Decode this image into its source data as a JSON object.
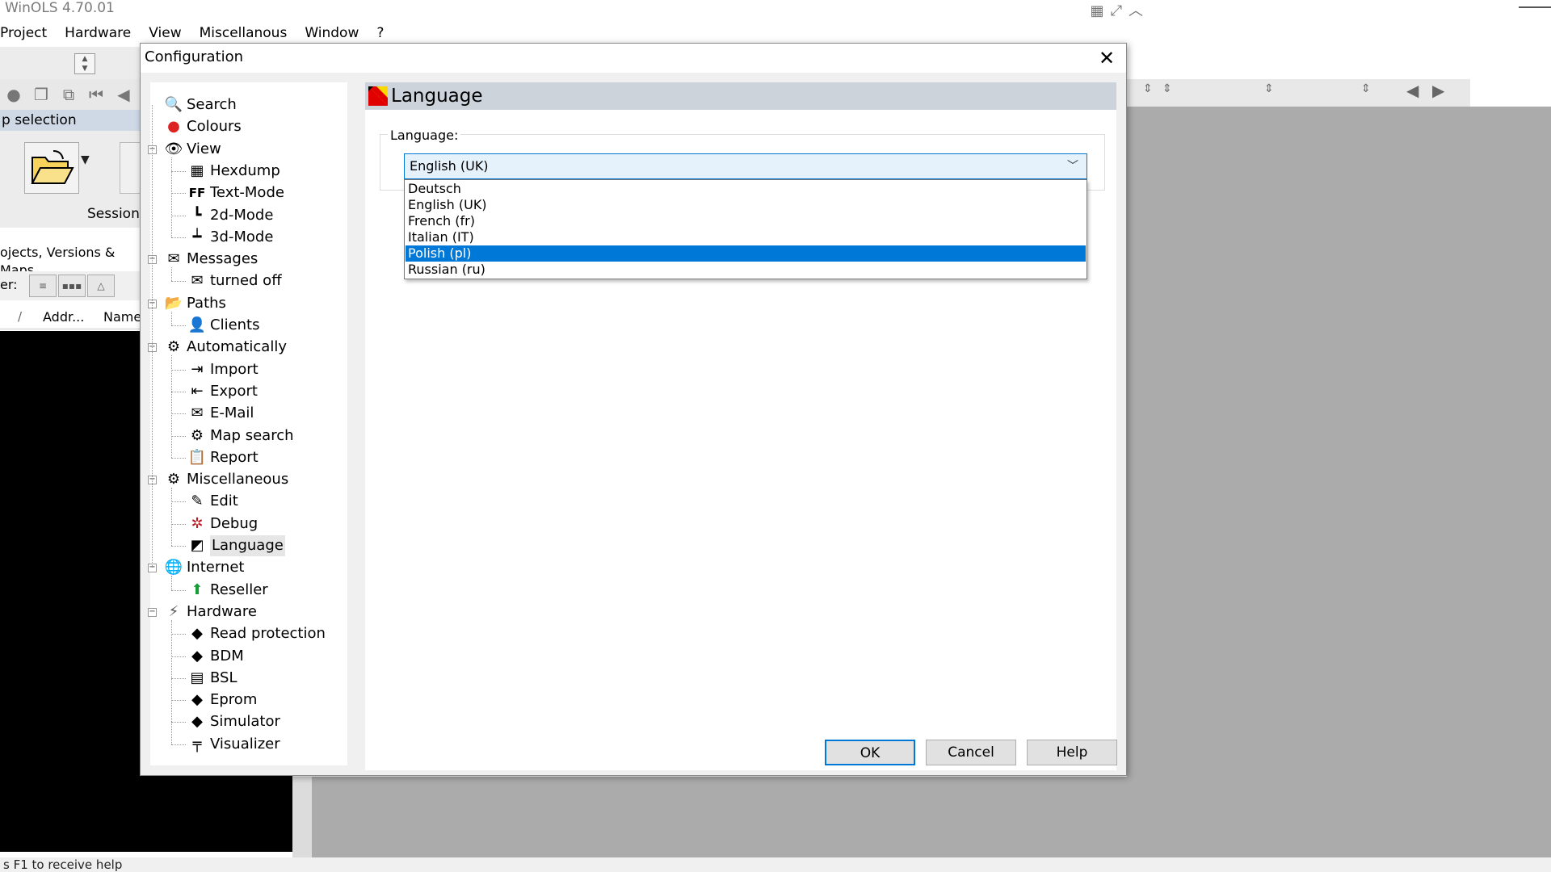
{
  "app": {
    "title": "WinOLS 4.70.01",
    "menu": [
      "Project",
      "Hardware",
      "View",
      "Miscellanous",
      "Window",
      "?"
    ]
  },
  "background": {
    "map_selection_title": "p selection",
    "session_label": "Session:",
    "projects_tab": "ojects, Versions & Maps",
    "filter_label": "er:",
    "col_slash": "/",
    "col_address": "Addr...",
    "col_name": "Name",
    "status_text": "s F1 to receive help"
  },
  "dialog": {
    "title": "Configuration",
    "close_glyph": "✕",
    "tree": [
      {
        "label": "Search",
        "icon": "search-icon",
        "glyph": "🔍"
      },
      {
        "label": "Colours",
        "icon": "colours-icon",
        "glyph": "●"
      },
      {
        "label": "View",
        "icon": "eye-icon",
        "glyph": "👁"
      },
      {
        "label": "Hexdump",
        "icon": "hexdump-icon",
        "glyph": "▦"
      },
      {
        "label": "Text-Mode",
        "icon": "text-mode-icon",
        "glyph": "FF"
      },
      {
        "label": "2d-Mode",
        "icon": "2d-mode-icon",
        "glyph": "┗"
      },
      {
        "label": "3d-Mode",
        "icon": "3d-mode-icon",
        "glyph": "┷"
      },
      {
        "label": "Messages",
        "icon": "messages-icon",
        "glyph": "✉"
      },
      {
        "label": "turned off",
        "icon": "turned-off-icon",
        "glyph": "✉"
      },
      {
        "label": "Paths",
        "icon": "folder-icon",
        "glyph": "📂"
      },
      {
        "label": "Clients",
        "icon": "clients-icon",
        "glyph": "👤"
      },
      {
        "label": "Automatically",
        "icon": "automatically-icon",
        "glyph": "⚙"
      },
      {
        "label": "Import",
        "icon": "import-icon",
        "glyph": "⇥"
      },
      {
        "label": "Export",
        "icon": "export-icon",
        "glyph": "⇤"
      },
      {
        "label": "E-Mail",
        "icon": "email-icon",
        "glyph": "✉"
      },
      {
        "label": "Map search",
        "icon": "map-search-icon",
        "glyph": "⚙"
      },
      {
        "label": "Report",
        "icon": "report-icon",
        "glyph": "📋"
      },
      {
        "label": "Miscellaneous",
        "icon": "miscellaneous-icon",
        "glyph": "⚙"
      },
      {
        "label": "Edit",
        "icon": "edit-icon",
        "glyph": "✎"
      },
      {
        "label": "Debug",
        "icon": "debug-icon",
        "glyph": "✲"
      },
      {
        "label": "Language",
        "icon": "language-flag-icon",
        "glyph": "◩"
      },
      {
        "label": "Internet",
        "icon": "globe-icon",
        "glyph": "🌐"
      },
      {
        "label": "Reseller",
        "icon": "reseller-icon",
        "glyph": "⬆"
      },
      {
        "label": "Hardware",
        "icon": "hardware-icon",
        "glyph": "⚡"
      },
      {
        "label": "Read protection",
        "icon": "read-protection-icon",
        "glyph": "◆"
      },
      {
        "label": "BDM",
        "icon": "bdm-icon",
        "glyph": "◆"
      },
      {
        "label": "BSL",
        "icon": "bsl-icon",
        "glyph": "▤"
      },
      {
        "label": "Eprom",
        "icon": "eprom-icon",
        "glyph": "◆"
      },
      {
        "label": "Simulator",
        "icon": "simulator-icon",
        "glyph": "◆"
      },
      {
        "label": "Visualizer",
        "icon": "visualizer-icon",
        "glyph": "╤"
      }
    ],
    "selected_tree_item": "Language",
    "content": {
      "header_title": "Language",
      "group_label": "Language:",
      "combo_value": "English (UK)",
      "options": [
        "Deutsch",
        "English (UK)",
        "French (fr)",
        "Italian (IT)",
        "Polish (pl)",
        "Russian (ru)"
      ],
      "highlighted_option": "Polish (pl)"
    },
    "buttons": {
      "ok": "OK",
      "cancel": "Cancel",
      "help": "Help"
    }
  },
  "colors": {
    "accent": "#0078d7",
    "header_bg": "#cdd3db",
    "dialog_bg": "#f0f0f0"
  }
}
